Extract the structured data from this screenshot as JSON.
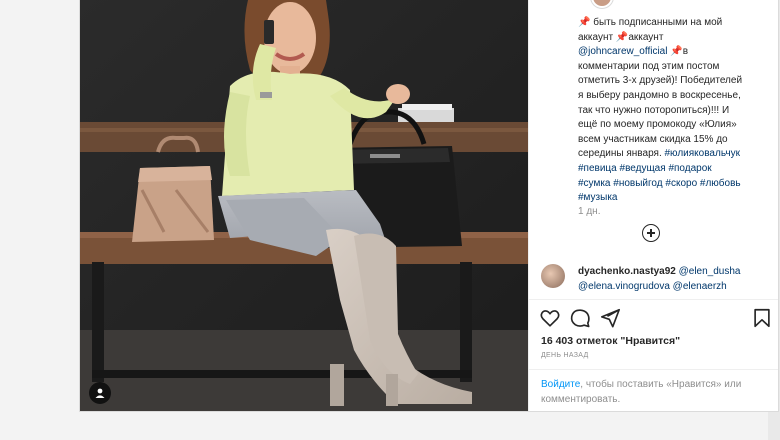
{
  "post": {
    "caption": {
      "line1": "📌 быть подписанными на мой",
      "line2": "аккаунт 📌аккаунт",
      "mention": "@johncarew_official",
      "line3": " 📌в",
      "line4": "комментарии под этим постом",
      "line5": "отметить 3-х друзей)! Победителей",
      "line6": "я выберу рандомно в воскресенье,",
      "line7": "так что нужно поторопиться)!!! И",
      "line8": "ещё по моему промокоду «Юлия»",
      "line9": "всем участникам скидка 15% до",
      "line10": "середины января.",
      "tag1": "#юлияковальчук",
      "tag2": "#певица",
      "tag3": "#ведущая",
      "tag4": "#подарок",
      "tag5": "#сумка",
      "tag6": "#новыйгод",
      "tag7": "#скоро",
      "tag8": "#любовь",
      "tag9": "#музыка"
    },
    "time_ago": "1 дн.",
    "load_more_icon": "plus-circle-icon",
    "comment": {
      "username": "dyachenko.nastya92",
      "mention1": "@elen_dusha",
      "mention2": "@elena.vinogrudova",
      "mention3": "@elenaerzh"
    },
    "likes": "16 403 отметок \"Нравится\"",
    "when": "ДЕНЬ НАЗАД",
    "login": {
      "link": "Войдите",
      "text": ", чтобы поставить «Нравится» или комментировать."
    }
  },
  "icons": {
    "like": "heart-icon",
    "comment": "comment-icon",
    "share": "share-icon",
    "save": "bookmark-icon"
  },
  "colors": {
    "link": "#00376b",
    "login_link": "#0095f6",
    "muted": "#8e8e8e",
    "text": "#262626"
  }
}
